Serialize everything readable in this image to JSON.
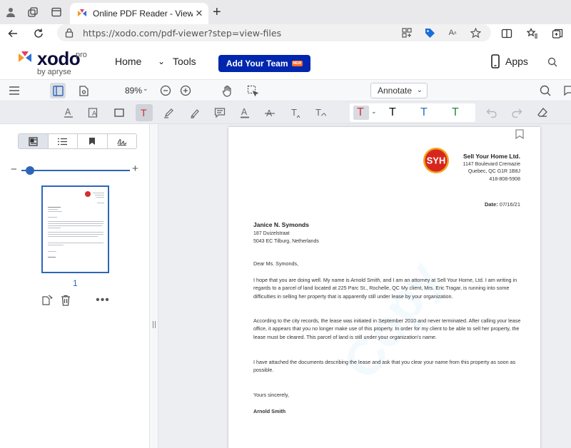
{
  "browser": {
    "tab_title": "Online PDF Reader - View PDFs O",
    "tab_close": "✕",
    "url": "https://xodo.com/pdf-viewer?step=view-files"
  },
  "app": {
    "logo_word": "xodo",
    "logo_pro": "pro",
    "logo_by": "by apryse",
    "nav_home": "Home",
    "nav_tools": "Tools",
    "team_button": "Add Your Team",
    "team_badge": "NEW",
    "apps_label": "Apps",
    "accent_color": "#0026ae"
  },
  "toolbar": {
    "zoom": "89%",
    "mode_select": "Annotate"
  },
  "text_colors": [
    "#d32f2f",
    "#111111",
    "#2d6fc4",
    "#1f8a3a"
  ],
  "sidebar": {
    "page_number": "1"
  },
  "letter": {
    "company_name": "Sell Your Home Ltd.",
    "company_address_1": "1147 Boulevard Cremazie",
    "company_address_2": "Quebec, QC G1R 1B8J",
    "company_phone": "418-808-5908",
    "logo_text": "SYH",
    "date_label": "Date:",
    "date_value": "07/16/21",
    "recipient_name": "Janice N. Symonds",
    "recipient_address_1": "187 Duizelstraat",
    "recipient_address_2": "5043 EC Tilburg, Netherlands",
    "salutation": "Dear Ms. Symonds,",
    "para1": "I hope that you are doing well. My name is Arnold Smith, and I am an attorney at Sell Your Home, Ltd. I am writing in regards to a parcel of land located at 225 Parc St., Rochelle, QC  My client, Mrs. Eric Tragar, is running into some difficulties in selling her property that is apparently still under lease by your organization.",
    "para2": "According to the city records, the lease was initiated in September 2010 and never terminated. After calling your lease office, it appears that you no longer make use of this property. In order for my client to be able to sell her property, the lease must be cleared. This parcel of land is still under your organization's name.",
    "para3": "I have attached the documents describing the lease and ask that you clear your name from this property as soon as possible.",
    "closing": "Yours sincerely,",
    "signature": "Arnold Smith",
    "watermark": "Copy"
  }
}
